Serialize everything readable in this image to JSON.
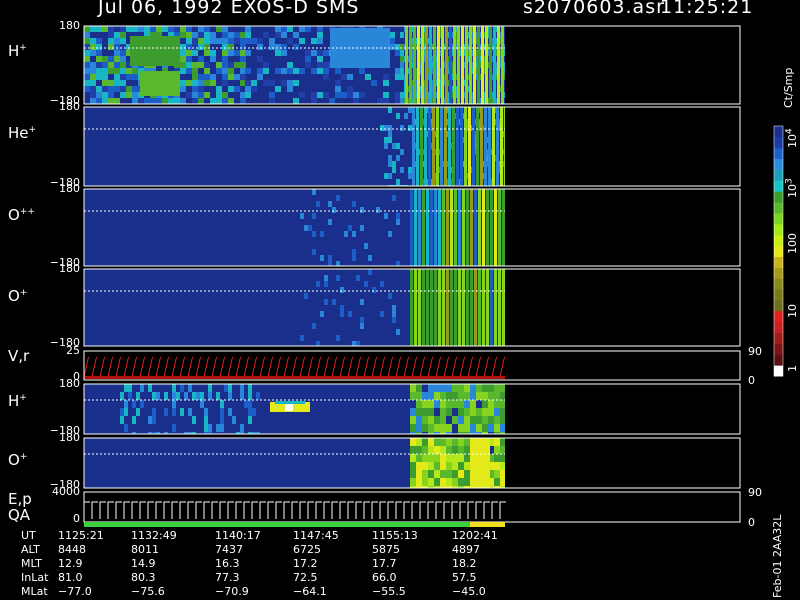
{
  "header": {
    "title": "Jul 06, 1992    EXOS-D SMS",
    "file": "s2070603.asr",
    "time": "11:25:21"
  },
  "panels": [
    {
      "base": "H",
      "charge": "+",
      "ticks": [
        "180",
        "−180"
      ]
    },
    {
      "base": "He",
      "charge": "+",
      "ticks": [
        "180",
        "−180"
      ]
    },
    {
      "base": "O",
      "charge": "++",
      "ticks": [
        "180",
        "−180"
      ]
    },
    {
      "base": "O",
      "charge": "+",
      "ticks": [
        "180",
        "−180"
      ]
    },
    {
      "base": "V,r",
      "charge": "",
      "ticks": [
        "25",
        "0"
      ],
      "right_ticks": [
        "90",
        "0"
      ]
    },
    {
      "base": "H",
      "charge": "+",
      "ticks": [
        "180",
        "−180"
      ]
    },
    {
      "base": "O",
      "charge": "+",
      "ticks": [
        "180",
        "−180"
      ]
    },
    {
      "base": "E,p",
      "charge": "",
      "ticks": [
        "4000",
        "0"
      ],
      "right_ticks": [
        "90",
        "0"
      ]
    }
  ],
  "qa_label": "QA",
  "colorbar": {
    "unit": "Ct/Smp",
    "labels": [
      {
        "base": "10",
        "exp": "4"
      },
      {
        "base": "10",
        "exp": "3"
      },
      {
        "base": "100",
        "exp": ""
      },
      {
        "base": "10",
        "exp": ""
      },
      {
        "base": "1",
        "exp": ""
      }
    ],
    "colors": [
      "#1b2f8a",
      "#1a3fa0",
      "#1c60c8",
      "#2a8ed8",
      "#1aa0b8",
      "#18c4c4",
      "#3b9d2e",
      "#5ab82e",
      "#7dd41e",
      "#a2e81a",
      "#c8f00e",
      "#e6e81a",
      "#c8b41a",
      "#a89a1a",
      "#8a8a1a",
      "#7a7a1a",
      "#6e6e20",
      "#dd2222",
      "#c42222",
      "#a01e1e",
      "#7a1515",
      "#5a1010",
      "#ffffff"
    ]
  },
  "side_label": "Feb-01 2AA32L",
  "footer": {
    "rows": [
      {
        "label": "UT",
        "values": [
          "1125:21",
          "1132:49",
          "1140:17",
          "1147:45",
          "1155:13",
          "1202:41"
        ]
      },
      {
        "label": "ALT",
        "values": [
          "8448",
          "8011",
          "7437",
          "6725",
          "5875",
          "4897"
        ]
      },
      {
        "label": "MLT",
        "values": [
          "12.9",
          "14.9",
          "16.3",
          "17.2",
          "17.7",
          "18.2"
        ]
      },
      {
        "label": "InLat",
        "values": [
          "81.0",
          "80.3",
          "77.3",
          "72.5",
          "66.0",
          "57.5"
        ]
      },
      {
        "label": "MLat",
        "values": [
          "−77.0",
          "−75.6",
          "−70.9",
          "−64.1",
          "−55.5",
          "−45.0"
        ]
      }
    ]
  },
  "chart_data": {
    "type": "heatmap",
    "title": "Jul 06, 1992    EXOS-D SMS",
    "x_tick_labels": [
      "1125:21",
      "1132:49",
      "1140:17",
      "1147:45",
      "1155:13",
      "1202:41"
    ],
    "series": [
      {
        "name": "H+",
        "ylim": [
          -180,
          180
        ]
      },
      {
        "name": "He+",
        "ylim": [
          -180,
          180
        ]
      },
      {
        "name": "O++",
        "ylim": [
          -180,
          180
        ]
      },
      {
        "name": "O+",
        "ylim": [
          -180,
          180
        ]
      },
      {
        "name": "V,r",
        "ylim": [
          0,
          25
        ],
        "right_ylim": [
          0,
          90
        ]
      },
      {
        "name": "H+",
        "ylim": [
          -180,
          180
        ]
      },
      {
        "name": "O+",
        "ylim": [
          -180,
          180
        ]
      },
      {
        "name": "E,p",
        "ylim": [
          0,
          4000
        ],
        "right_ylim": [
          0,
          90
        ]
      }
    ],
    "colorbar_unit": "Ct/Smp",
    "colorbar_scale": "log",
    "colorbar_range": [
      1,
      10000
    ]
  }
}
